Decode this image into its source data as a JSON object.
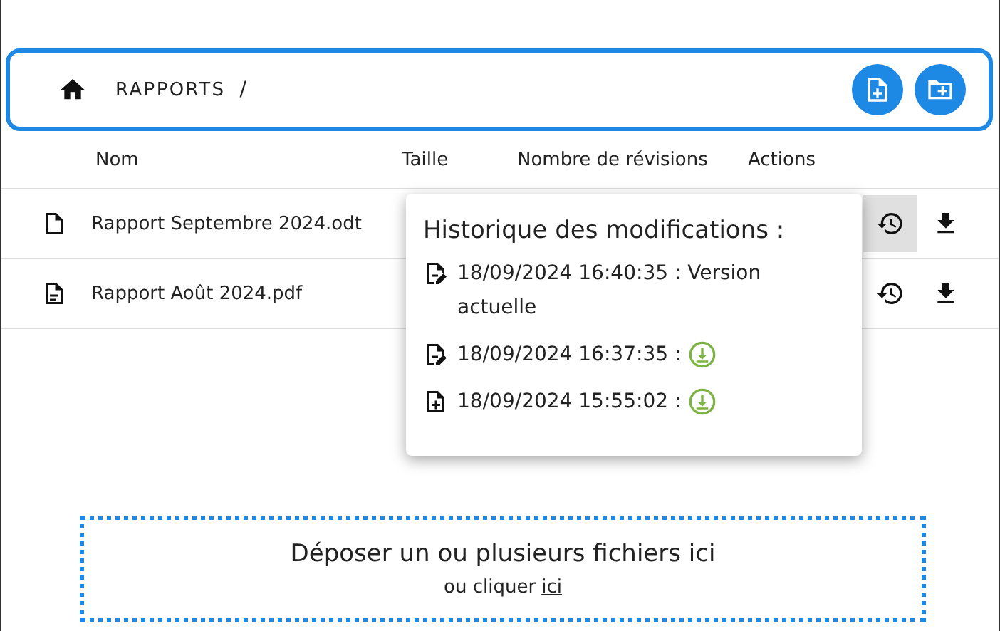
{
  "breadcrumb": {
    "items": [
      "RAPPORTS"
    ],
    "separator": "/"
  },
  "table": {
    "columns": [
      "Nom",
      "Taille",
      "Nombre de révisions",
      "Actions"
    ],
    "rows": [
      {
        "kind": "blank",
        "name": "Rapport Septembre 2024.odt",
        "history_open": true
      },
      {
        "kind": "text",
        "name": "Rapport Août 2024.pdf",
        "history_open": false
      }
    ]
  },
  "history": {
    "title": "Historique des modifications :",
    "entries": [
      {
        "kind": "edit",
        "time": "18/09/2024 16:40:35 :",
        "note": "Version actuelle",
        "downloadable": false
      },
      {
        "kind": "edit",
        "time": "18/09/2024 16:37:35 :",
        "downloadable": true
      },
      {
        "kind": "create",
        "time": "18/09/2024 15:55:02 :",
        "downloadable": true
      }
    ]
  },
  "dropzone": {
    "title": "Déposer un ou plusieurs fichiers ici",
    "prefix": "ou cliquer",
    "link": "ici"
  }
}
